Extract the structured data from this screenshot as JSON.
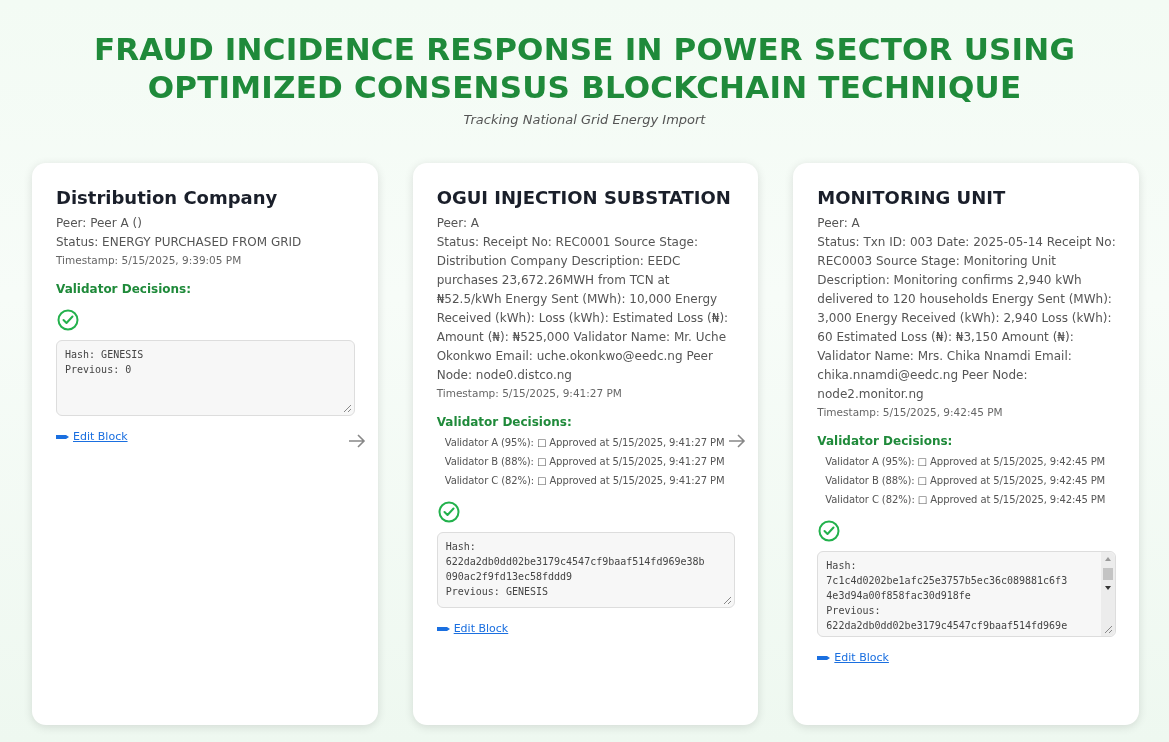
{
  "header": {
    "title": "FRAUD INCIDENCE RESPONSE IN POWER SECTOR USING OPTIMIZED CONSENSUS BLOCKCHAIN TECHNIQUE",
    "subtitle": "Tracking National Grid Energy Import"
  },
  "blocks": [
    {
      "title": "Distribution Company",
      "peer": "Peer: Peer A ()",
      "status": "Status: ENERGY PURCHASED FROM GRID",
      "timestamp": "Timestamp: 5/15/2025, 9:39:05 PM",
      "decisions_label": "Validator Decisions:",
      "hash_text": "Hash: GENESIS\nPrevious: 0",
      "scroll": false,
      "edit_link": "Edit Block",
      "arrow": true
    },
    {
      "title": "OGUI INJECTION SUBSTATION",
      "peer": "Peer: A",
      "status": "Status: Receipt No: REC0001 Source Stage: Distribution Company Description: EEDC purchases 23,672.26MWH from TCN at ₦52.5/kWh Energy Sent (MWh): 10,000 Energy Received (kWh): Loss (kWh): Estimated Loss (₦): Amount (₦): ₦525,000 Validator Name: Mr. Uche Okonkwo Email: uche.okonkwo@eedc.ng Peer Node: node0.distco.ng",
      "timestamp": "Timestamp: 5/15/2025, 9:41:27 PM",
      "decisions_label": "Validator Decisions:",
      "decisions": [
        "Validator A (95%): □ Approved at 5/15/2025, 9:41:27 PM",
        "Validator B (88%): □ Approved at 5/15/2025, 9:41:27 PM",
        "Validator C (82%): □ Approved at 5/15/2025, 9:41:27 PM"
      ],
      "hash_text": "Hash:\n622da2db0dd02be3179c4547cf9baaf514fd969e38b090ac2f9fd13ec58fddd9\nPrevious: GENESIS",
      "scroll": false,
      "edit_link": "Edit Block",
      "arrow": true
    },
    {
      "title": "MONITORING UNIT",
      "peer": "Peer: A",
      "status": "Status: Txn ID: 003 Date: 2025-05-14 Receipt No: REC0003 Source Stage: Monitoring Unit Description: Monitoring confirms 2,940 kWh delivered to 120 households Energy Sent (MWh): 3,000 Energy Received (kWh): 2,940 Loss (kWh): 60 Estimated Loss (₦): ₦3,150 Amount (₦): Validator Name: Mrs. Chika Nnamdi Email: chika.nnamdi@eedc.ng Peer Node: node2.monitor.ng",
      "timestamp": "Timestamp: 5/15/2025, 9:42:45 PM",
      "decisions_label": "Validator Decisions:",
      "decisions": [
        "Validator A (95%): □ Approved at 5/15/2025, 9:42:45 PM",
        "Validator B (88%): □ Approved at 5/15/2025, 9:42:45 PM",
        "Validator C (82%): □ Approved at 5/15/2025, 9:42:45 PM"
      ],
      "hash_text": "Hash:\n7c1c4d0202be1afc25e3757b5ec36c089881c6f34e3d94a00f858fac30d918fe\nPrevious:\n622da2db0dd02be3179c4547cf9baaf514fd969e",
      "scroll": true,
      "edit_link": "Edit Block",
      "arrow": false
    }
  ]
}
